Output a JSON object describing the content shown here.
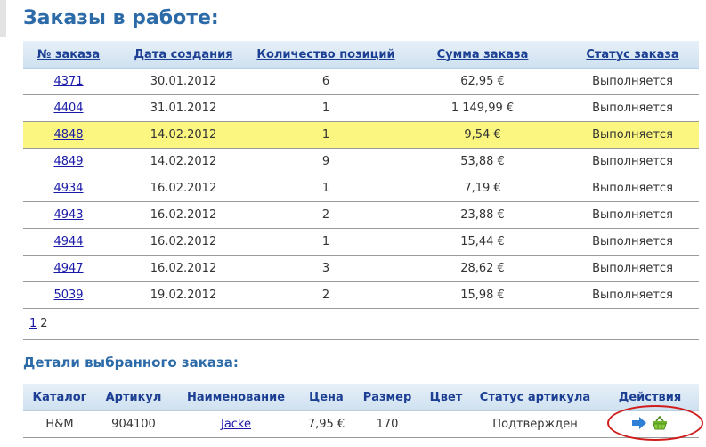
{
  "page": {
    "title": "Заказы в работе:"
  },
  "orders": {
    "headers": [
      "№ заказа",
      "Дата создания",
      "Количество позиций",
      "Сумма заказа",
      "Статус заказа"
    ],
    "rows": [
      {
        "id": "4371",
        "date": "30.01.2012",
        "count": "6",
        "sum": "62,95 €",
        "status": "Выполняется"
      },
      {
        "id": "4404",
        "date": "31.01.2012",
        "count": "1",
        "sum": "1 149,99 €",
        "status": "Выполняется"
      },
      {
        "id": "4848",
        "date": "14.02.2012",
        "count": "1",
        "sum": "9,54 €",
        "status": "Выполняется"
      },
      {
        "id": "4849",
        "date": "14.02.2012",
        "count": "9",
        "sum": "53,88 €",
        "status": "Выполняется"
      },
      {
        "id": "4934",
        "date": "16.02.2012",
        "count": "1",
        "sum": "7,19 €",
        "status": "Выполняется"
      },
      {
        "id": "4943",
        "date": "16.02.2012",
        "count": "2",
        "sum": "23,88 €",
        "status": "Выполняется"
      },
      {
        "id": "4944",
        "date": "16.02.2012",
        "count": "1",
        "sum": "15,44 €",
        "status": "Выполняется"
      },
      {
        "id": "4947",
        "date": "16.02.2012",
        "count": "3",
        "sum": "28,62 €",
        "status": "Выполняется"
      },
      {
        "id": "5039",
        "date": "19.02.2012",
        "count": "2",
        "sum": "15,98 €",
        "status": "Выполняется"
      }
    ],
    "selected_index": 2
  },
  "pager": {
    "pages": [
      "1",
      "2"
    ],
    "current": "2"
  },
  "details": {
    "title": "Детали выбранного заказа:",
    "headers": [
      "Каталог",
      "Артикул",
      "Наименование",
      "Цена",
      "Размер",
      "Цвет",
      "Статус артикула",
      "Действия"
    ],
    "rows": [
      {
        "catalog": "H&M",
        "article": "904100",
        "name": "Jacke",
        "price": "7,95 €",
        "size": "170",
        "color": "",
        "status": "Подтвержден",
        "actions": [
          {
            "icon": "arrow-right-icon"
          },
          {
            "icon": "basket-icon"
          }
        ]
      }
    ]
  },
  "colors": {
    "title": "#2c6ba8",
    "link": "#1a1aa8",
    "selected_row": "#fbf680",
    "highlight_ring": "#d11c1c"
  }
}
